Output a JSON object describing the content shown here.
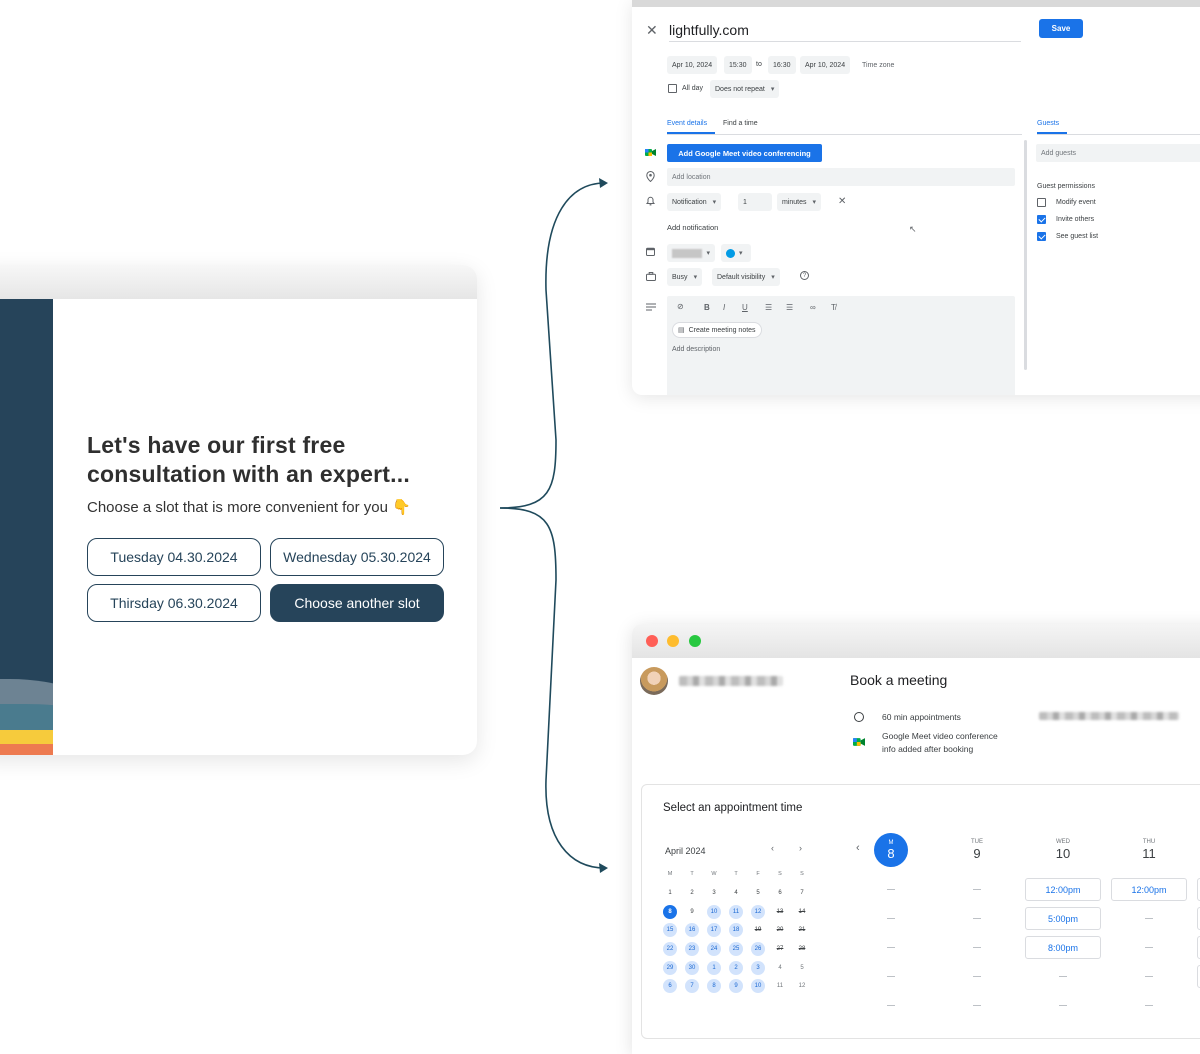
{
  "consult": {
    "title": "Let's have our first free consultation with an expert...",
    "subtitle": "Choose a slot that is more convenient for you 👇",
    "slots": [
      "Tuesday 04.30.2024",
      "Wednesday 05.30.2024",
      "Thirsday 06.30.2024"
    ],
    "other_slot": "Choose another slot",
    "colors": {
      "primary": "#26445a",
      "accent_yellow": "#f6cb3c",
      "accent_orange": "#ed7a50"
    }
  },
  "editor": {
    "title": "lightfully.com",
    "save": "Save",
    "start_date": "Apr 10, 2024",
    "start_time": "15:30",
    "to": "to",
    "end_time": "16:30",
    "end_date": "Apr 10, 2024",
    "time_zone": "Time zone",
    "all_day": "All day",
    "repeat": "Does not repeat",
    "tab_details": "Event details",
    "tab_find": "Find a time",
    "tab_guests": "Guests",
    "meet_button": "Add Google Meet video conferencing",
    "add_location": "Add location",
    "notification": "Notification",
    "notif_value": "1",
    "notif_unit": "minutes",
    "add_notification": "Add notification",
    "busy": "Busy",
    "visibility": "Default visibility",
    "create_notes": "Create meeting notes",
    "add_description": "Add description",
    "add_guests": "Add guests",
    "guest_permissions": "Guest permissions",
    "perm_modify": "Modify event",
    "perm_invite": "Invite others",
    "perm_see": "See guest list",
    "accent": "#1a73e8"
  },
  "booking": {
    "title": "Book a meeting",
    "duration": "60 min appointments",
    "meet_info_1": "Google Meet video conference",
    "meet_info_2": "info added after booking",
    "panel_title": "Select an appointment time",
    "month": "April 2024",
    "weekdays": [
      "M",
      "T",
      "W",
      "T",
      "F",
      "S",
      "S"
    ],
    "calendar": [
      [
        "1",
        "2",
        "3",
        "4",
        "5",
        "6",
        "7"
      ],
      [
        "8",
        "9",
        "10",
        "11",
        "12",
        "13",
        "14"
      ],
      [
        "15",
        "16",
        "17",
        "18",
        "19",
        "20",
        "21"
      ],
      [
        "22",
        "23",
        "24",
        "25",
        "26",
        "27",
        "28"
      ],
      [
        "29",
        "30",
        "1",
        "2",
        "3",
        "4",
        "5"
      ],
      [
        "6",
        "7",
        "8",
        "9",
        "10",
        "11",
        "12"
      ]
    ],
    "selected_day": "8",
    "days": [
      {
        "name": "M",
        "num": "8"
      },
      {
        "name": "TUE",
        "num": "9"
      },
      {
        "name": "WED",
        "num": "10"
      },
      {
        "name": "THU",
        "num": "11"
      }
    ],
    "wed_slots": [
      "12:00pm",
      "5:00pm",
      "8:00pm"
    ],
    "thu_slots": [
      "12:00pm"
    ]
  }
}
